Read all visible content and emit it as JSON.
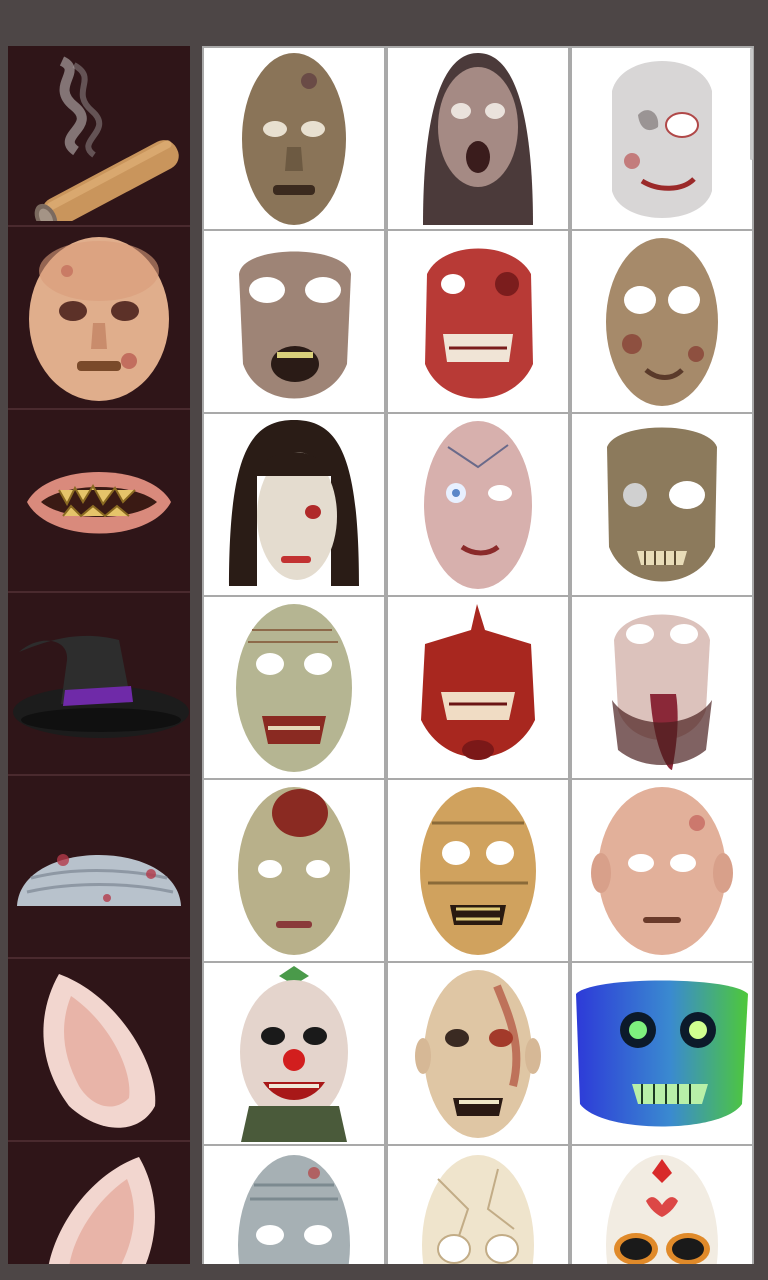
{
  "sidebar": {
    "items": [
      {
        "icon": "cigar-icon"
      },
      {
        "icon": "zombie-face-mask-icon"
      },
      {
        "icon": "monster-mouth-icon"
      },
      {
        "icon": "witch-hat-icon"
      },
      {
        "icon": "bald-cap-icon"
      },
      {
        "icon": "elf-ear-icon"
      },
      {
        "icon": "elf-ear-icon"
      }
    ]
  },
  "masks": {
    "rows": [
      [
        "zombie-mask-1",
        "zombie-mask-hooded",
        "zombie-mask-pale"
      ],
      [
        "zombie-mask-brown",
        "zombie-mask-bloody-skull",
        "zombie-mask-rotted"
      ],
      [
        "zombie-mask-long-hair",
        "zombie-mask-blue-eye",
        "zombie-mask-skull-grin"
      ],
      [
        "zombie-mask-bruised",
        "zombie-mask-jaw",
        "zombie-mask-tongue"
      ],
      [
        "zombie-mask-head-wound",
        "zombie-mask-mummy",
        "zombie-mask-scarred"
      ],
      [
        "clown-mask",
        "zombie-mask-red-veins",
        "ghost-mask-neon"
      ],
      [
        "zombie-mask-grey",
        "skull-mask-bone",
        "sugar-skull-mask"
      ]
    ]
  },
  "colors": {
    "background": "#4d4646",
    "sidebar": "#2f1518",
    "grid_line": "#a9a9a9",
    "cell": "#ffffff"
  }
}
